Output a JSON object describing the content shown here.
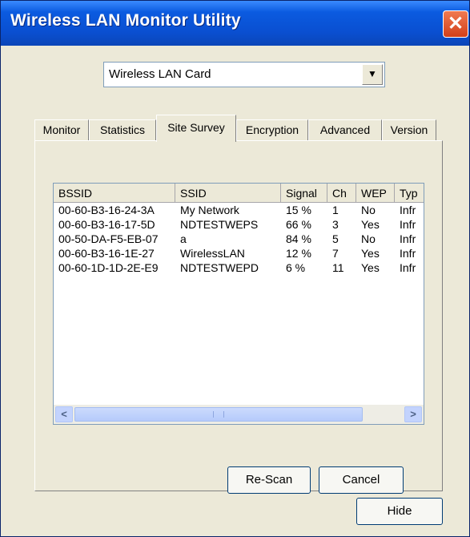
{
  "window": {
    "title": "Wireless LAN Monitor Utility"
  },
  "adapter": {
    "selected": "Wireless LAN Card"
  },
  "tabs": [
    "Monitor",
    "Statistics",
    "Site Survey",
    "Encryption",
    "Advanced",
    "Version"
  ],
  "active_tab": "Site Survey",
  "table": {
    "columns": [
      "BSSID",
      "SSID",
      "Signal",
      "Ch",
      "WEP",
      "Typ"
    ],
    "rows": [
      [
        "00-60-B3-16-24-3A",
        "My Network",
        "15 %",
        "1",
        "No",
        "Infr"
      ],
      [
        "00-60-B3-16-17-5D",
        "NDTESTWEPS",
        "66 %",
        "3",
        "Yes",
        "Infr"
      ],
      [
        "00-50-DA-F5-EB-07",
        "a",
        "84 %",
        "5",
        "No",
        "Infr"
      ],
      [
        "00-60-B3-16-1E-27",
        "WirelessLAN",
        "12 %",
        "7",
        "Yes",
        "Infr"
      ],
      [
        "00-60-1D-1D-2E-E9",
        "NDTESTWEPD",
        "6 %",
        "11",
        "Yes",
        "Infr"
      ]
    ]
  },
  "buttons": {
    "rescan": "Re-Scan",
    "cancel": "Cancel",
    "hide": "Hide"
  },
  "icons": {
    "close": "close-icon",
    "dropdown": "chevron-down-icon",
    "scroll_left": "arrow-left-icon",
    "scroll_right": "arrow-right-icon"
  }
}
